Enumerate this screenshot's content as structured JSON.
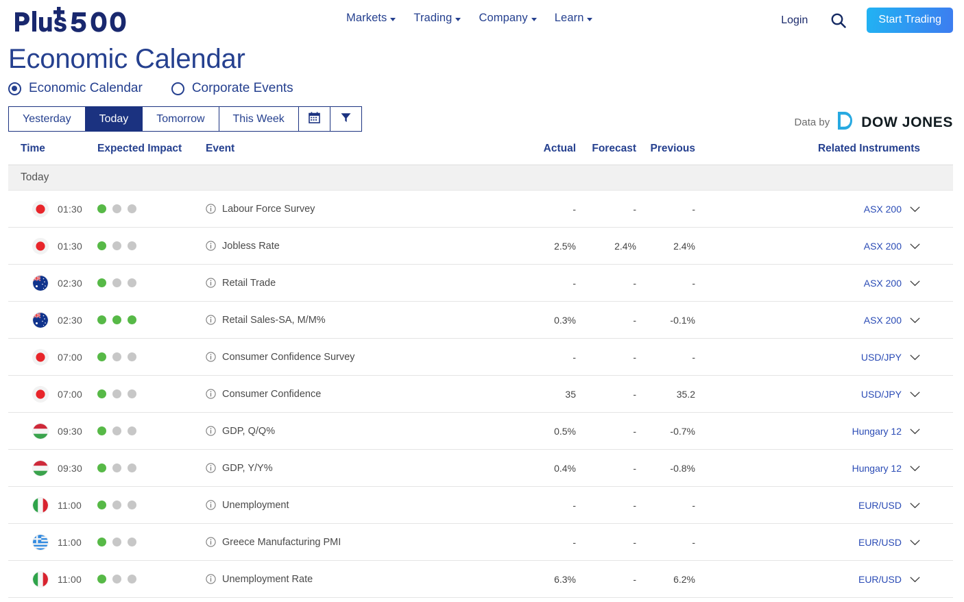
{
  "brand": {
    "logo_text": "Plus500"
  },
  "nav": {
    "menu": [
      {
        "label": "Markets",
        "icon": "chevron-down-icon"
      },
      {
        "label": "Trading",
        "icon": "chevron-down-icon"
      },
      {
        "label": "Company",
        "icon": "chevron-down-icon"
      },
      {
        "label": "Learn",
        "icon": "chevron-down-icon"
      }
    ],
    "login_label": "Login",
    "search_icon": "search-icon",
    "cta_label": "Start Trading",
    "cta_color": "#29a8f0"
  },
  "page": {
    "title": "Economic Calendar"
  },
  "view_toggle": {
    "options": [
      {
        "label": "Economic Calendar",
        "selected": true
      },
      {
        "label": "Corporate Events",
        "selected": false
      }
    ],
    "accent": "#25408f"
  },
  "tabs": {
    "items": [
      {
        "label": "Yesterday",
        "active": false
      },
      {
        "label": "Today",
        "active": true
      },
      {
        "label": "Tomorrow",
        "active": false
      },
      {
        "label": "This Week",
        "active": false
      }
    ],
    "calendar_icon": "calendar-icon",
    "filter_icon": "filter-icon",
    "active_color": "#1b3280"
  },
  "data_source": {
    "prefix": "Data by",
    "provider": "DOW JONES",
    "logo_icon": "dow-jones-d-icon",
    "logo_color": "#27a9e1"
  },
  "table": {
    "columns": {
      "time": "Time",
      "impact": "Expected Impact",
      "event": "Event",
      "actual": "Actual",
      "forecast": "Forecast",
      "previous": "Previous",
      "related": "Related Instruments"
    },
    "group_label": "Today",
    "impact_on_color": "#57b947",
    "impact_off_color": "#c7c7c7",
    "rows": [
      {
        "flag": "japan-flag",
        "time": "01:30",
        "impact": 1,
        "info_icon": "info-icon",
        "event": "Labour Force Survey",
        "actual": "-",
        "forecast": "-",
        "previous": "-",
        "related": "ASX 200",
        "chevron": "chevron-down-icon"
      },
      {
        "flag": "japan-flag",
        "time": "01:30",
        "impact": 1,
        "info_icon": "info-icon",
        "event": "Jobless Rate",
        "actual": "2.5%",
        "forecast": "2.4%",
        "previous": "2.4%",
        "related": "ASX 200",
        "chevron": "chevron-down-icon"
      },
      {
        "flag": "australia-flag",
        "time": "02:30",
        "impact": 1,
        "info_icon": "info-icon",
        "event": "Retail Trade",
        "actual": "-",
        "forecast": "-",
        "previous": "-",
        "related": "ASX 200",
        "chevron": "chevron-down-icon"
      },
      {
        "flag": "australia-flag",
        "time": "02:30",
        "impact": 3,
        "info_icon": "info-icon",
        "event": "Retail Sales-SA, M/M%",
        "actual": "0.3%",
        "forecast": "-",
        "previous": "-0.1%",
        "related": "ASX 200",
        "chevron": "chevron-down-icon"
      },
      {
        "flag": "japan-flag",
        "time": "07:00",
        "impact": 1,
        "info_icon": "info-icon",
        "event": "Consumer Confidence Survey",
        "actual": "-",
        "forecast": "-",
        "previous": "-",
        "related": "USD/JPY",
        "chevron": "chevron-down-icon"
      },
      {
        "flag": "japan-flag",
        "time": "07:00",
        "impact": 1,
        "info_icon": "info-icon",
        "event": "Consumer Confidence",
        "actual": "35",
        "forecast": "-",
        "previous": "35.2",
        "related": "USD/JPY",
        "chevron": "chevron-down-icon"
      },
      {
        "flag": "hungary-flag",
        "time": "09:30",
        "impact": 1,
        "info_icon": "info-icon",
        "event": "GDP, Q/Q%",
        "actual": "0.5%",
        "forecast": "-",
        "previous": "-0.7%",
        "related": "Hungary 12",
        "chevron": "chevron-down-icon"
      },
      {
        "flag": "hungary-flag",
        "time": "09:30",
        "impact": 1,
        "info_icon": "info-icon",
        "event": "GDP, Y/Y%",
        "actual": "0.4%",
        "forecast": "-",
        "previous": "-0.8%",
        "related": "Hungary 12",
        "chevron": "chevron-down-icon"
      },
      {
        "flag": "italy-flag",
        "time": "11:00",
        "impact": 1,
        "info_icon": "info-icon",
        "event": "Unemployment",
        "actual": "-",
        "forecast": "-",
        "previous": "-",
        "related": "EUR/USD",
        "chevron": "chevron-down-icon"
      },
      {
        "flag": "greece-flag",
        "time": "11:00",
        "impact": 1,
        "info_icon": "info-icon",
        "event": "Greece Manufacturing PMI",
        "actual": "-",
        "forecast": "-",
        "previous": "-",
        "related": "EUR/USD",
        "chevron": "chevron-down-icon"
      },
      {
        "flag": "italy-flag",
        "time": "11:00",
        "impact": 1,
        "info_icon": "info-icon",
        "event": "Unemployment Rate",
        "actual": "6.3%",
        "forecast": "-",
        "previous": "6.2%",
        "related": "EUR/USD",
        "chevron": "chevron-down-icon"
      }
    ]
  }
}
